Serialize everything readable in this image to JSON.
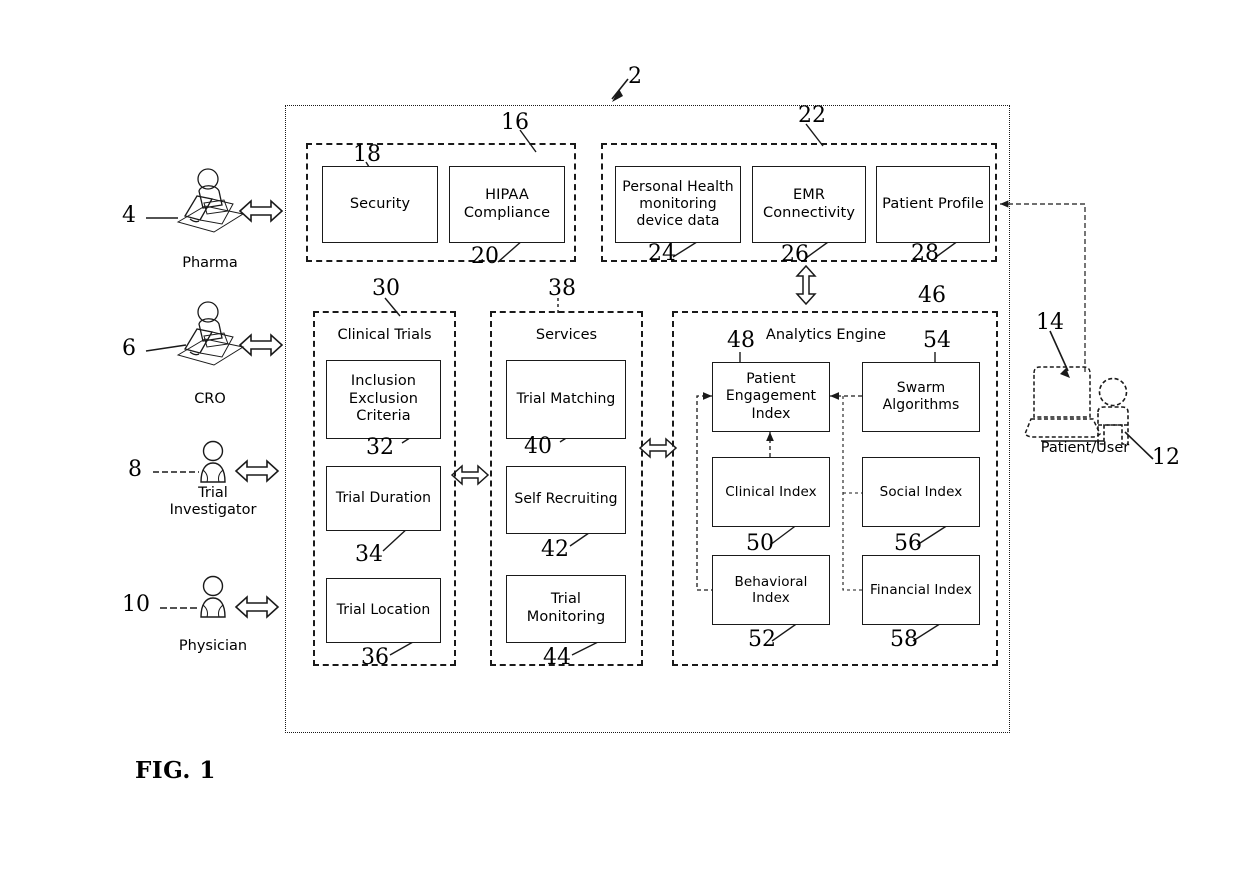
{
  "figure": {
    "caption": "FIG. 1",
    "system_ref": "2"
  },
  "actors": [
    {
      "ref": "4",
      "label": "Pharma",
      "icon": "person-at-laptop-icon"
    },
    {
      "ref": "6",
      "label": "CRO",
      "icon": "person-at-laptop-icon"
    },
    {
      "ref": "8",
      "label": "Trial\nInvestigator",
      "icon": "person-icon"
    },
    {
      "ref": "10",
      "label": "Physician",
      "icon": "person-icon"
    }
  ],
  "right_side": {
    "laptop_ref": "14",
    "laptop_icon": "laptop-icon",
    "person_ref": "12",
    "person_icon": "person-icon",
    "label": "Patient/User"
  },
  "groups": [
    {
      "id": "compliance",
      "ref": "16",
      "title": "",
      "boxes": [
        {
          "ref": "18",
          "label": "Security"
        },
        {
          "ref": "20",
          "label": "HIPAA\nCompliance"
        }
      ]
    },
    {
      "id": "patient-data",
      "ref": "22",
      "title": "",
      "boxes": [
        {
          "ref": "24",
          "label": "Personal Health\nmonitoring\ndevice data"
        },
        {
          "ref": "26",
          "label": "EMR\nConnectivity"
        },
        {
          "ref": "28",
          "label": "Patient Profile"
        }
      ]
    },
    {
      "id": "clinical-trials",
      "ref": "30",
      "title": "Clinical Trials",
      "boxes": [
        {
          "ref": "32",
          "label": "Inclusion\nExclusion\nCriteria"
        },
        {
          "ref": "34",
          "label": "Trial Duration"
        },
        {
          "ref": "36",
          "label": "Trial Location"
        }
      ]
    },
    {
      "id": "services",
      "ref": "38",
      "title": "Services",
      "boxes": [
        {
          "ref": "40",
          "label": "Trial Matching"
        },
        {
          "ref": "42",
          "label": "Self Recruiting"
        },
        {
          "ref": "44",
          "label": "Trial\nMonitoring"
        }
      ]
    },
    {
      "id": "analytics-engine",
      "ref": "46",
      "title": "Analytics Engine",
      "boxes": [
        {
          "ref": "48",
          "label": "Patient\nEngagement\nIndex"
        },
        {
          "ref": "54",
          "label": "Swarm\nAlgorithms"
        },
        {
          "ref": "50",
          "label": "Clinical Index"
        },
        {
          "ref": "56",
          "label": "Social Index"
        },
        {
          "ref": "52",
          "label": "Behavioral\nIndex"
        },
        {
          "ref": "58",
          "label": "Financial Index"
        }
      ]
    }
  ],
  "colors": {
    "ink": "#1a1a1a",
    "background": "#ffffff"
  }
}
